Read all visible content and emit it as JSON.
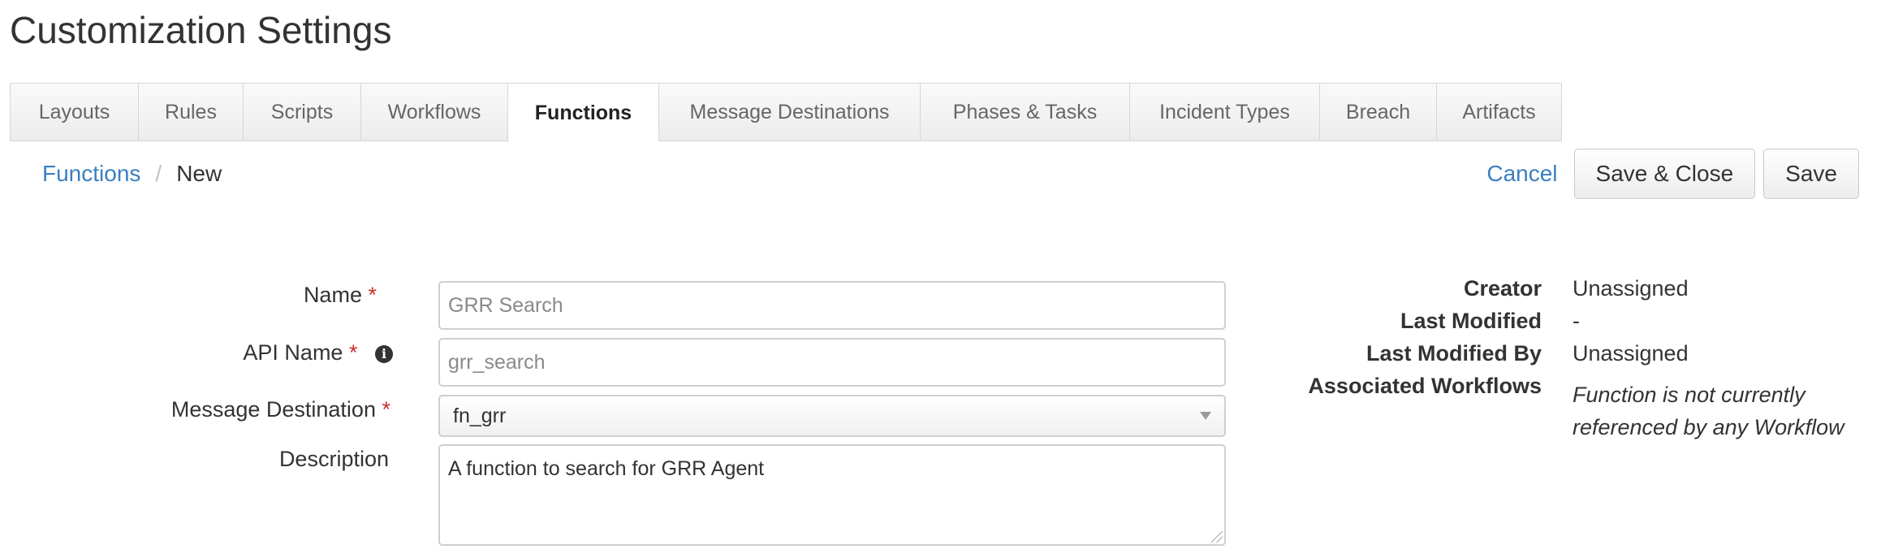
{
  "page_title": "Customization Settings",
  "tabs": [
    {
      "label": "Layouts",
      "active": false
    },
    {
      "label": "Rules",
      "active": false
    },
    {
      "label": "Scripts",
      "active": false
    },
    {
      "label": "Workflows",
      "active": false
    },
    {
      "label": "Functions",
      "active": true
    },
    {
      "label": "Message Destinations",
      "active": false
    },
    {
      "label": "Phases & Tasks",
      "active": false
    },
    {
      "label": "Incident Types",
      "active": false
    },
    {
      "label": "Breach",
      "active": false
    },
    {
      "label": "Artifacts",
      "active": false
    }
  ],
  "breadcrumb": {
    "parent": "Functions",
    "separator": "/",
    "current": "New"
  },
  "actions": {
    "cancel": "Cancel",
    "save_close": "Save & Close",
    "save": "Save"
  },
  "form": {
    "name_label": "Name",
    "name_placeholder": "GRR Search",
    "api_name_label": "API Name",
    "api_name_placeholder": "grr_search",
    "message_destination_label": "Message Destination",
    "message_destination_value": "fn_grr",
    "description_label": "Description",
    "description_value": "A function to search for GRR Agent",
    "required_marker": "*",
    "info_icon_glyph": "i"
  },
  "meta": {
    "creator_label": "Creator",
    "creator_value": "Unassigned",
    "last_modified_label": "Last Modified",
    "last_modified_value": "-",
    "last_modified_by_label": "Last Modified By",
    "last_modified_by_value": "Unassigned",
    "associated_workflows_label": "Associated Workflows",
    "associated_workflows_value": "Function is not currently referenced by any Workflow"
  },
  "colors": {
    "link": "#3a7fc1",
    "required": "#c9302c"
  }
}
